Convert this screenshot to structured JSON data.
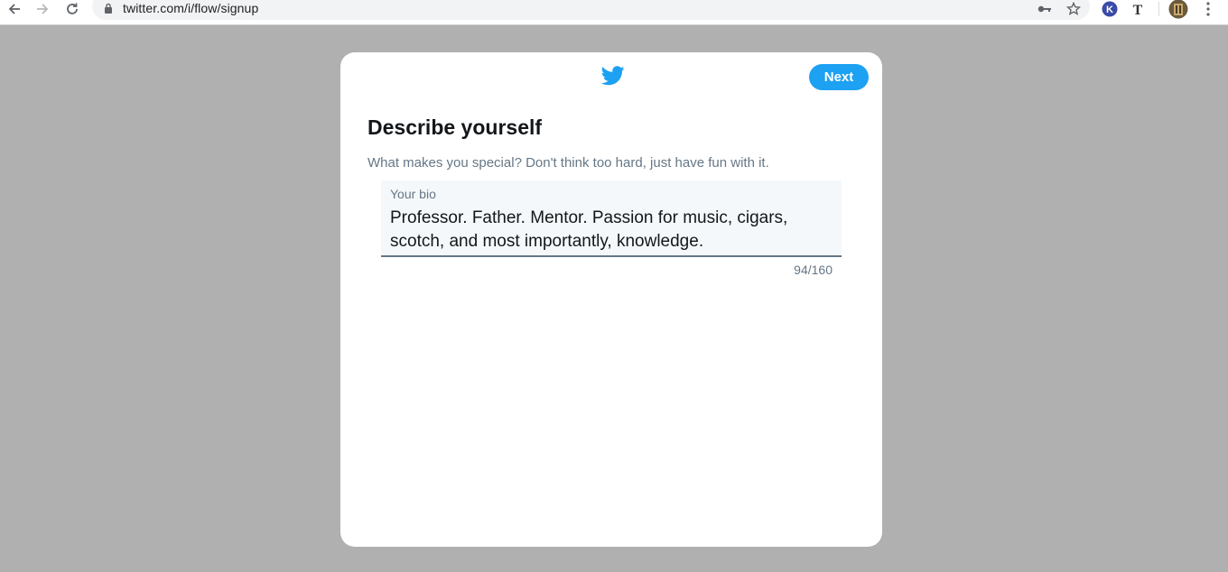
{
  "browser": {
    "url": "twitter.com/i/flow/signup",
    "icons": [
      "back-arrow-icon",
      "forward-arrow-icon",
      "reload-icon",
      "lock-icon",
      "key-icon",
      "star-icon",
      "k-extension-icon",
      "t-extension-icon",
      "profile-avatar-icon",
      "menu-dots-icon"
    ]
  },
  "modal": {
    "logo": "twitter-bird-icon",
    "next_label": "Next",
    "title": "Describe yourself",
    "subtitle": "What makes you special? Don't think too hard, just have fun with it.",
    "bio": {
      "label": "Your bio",
      "value": "Professor. Father. Mentor. Passion for music, cigars, scotch, and most importantly, knowledge.",
      "counter": "94/160"
    }
  },
  "colors": {
    "accent": "#1da1f2",
    "backdrop": "#b0b0b0",
    "text_primary": "#14171a",
    "text_secondary": "#657786"
  }
}
